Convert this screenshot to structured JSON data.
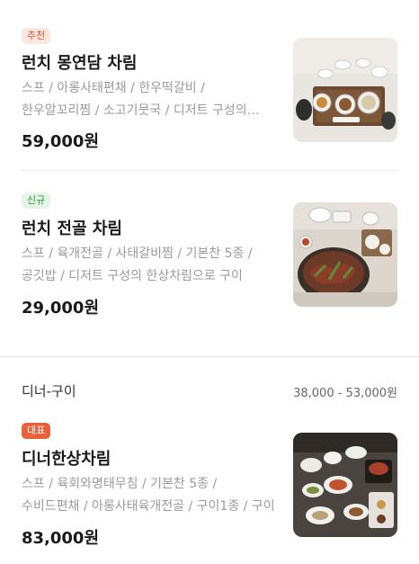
{
  "menu_items": [
    {
      "badge": "추천",
      "name": "런치 몽연담 차림",
      "description": "스프 / 아롱사태편채 / 한우떡갈비 / 한우알꼬리찜 / 소고기뭇국 / 디저트 구성의 한상차림",
      "price": "59,000원"
    },
    {
      "badge": "신규",
      "name": "런치 전골 차림",
      "description": "스프 / 육개전골 / 사태갈비찜 / 기본찬 5종 / 공깃밥 / 디저트 구성의 한상차림으로 구이",
      "price": "29,000원"
    },
    {
      "badge": "대표",
      "name": "디너한상차림",
      "description": "스프 / 육회와명태무침 / 기본찬 5종 / 수비드편채 / 아롱사태육개전골 / 구이1종 / 구이",
      "price": "83,000원"
    }
  ],
  "section": {
    "title": "디너-구이",
    "price_range": "38,000 - 53,000원"
  },
  "colors": {
    "badge_recommend": "#e0522d",
    "badge_new": "#2f9a45",
    "badge_signature": "#e9603a"
  },
  "icons": [
    "food-photo-korean-table-setting",
    "food-photo-hotpot-setting",
    "food-photo-dinner-course"
  ]
}
